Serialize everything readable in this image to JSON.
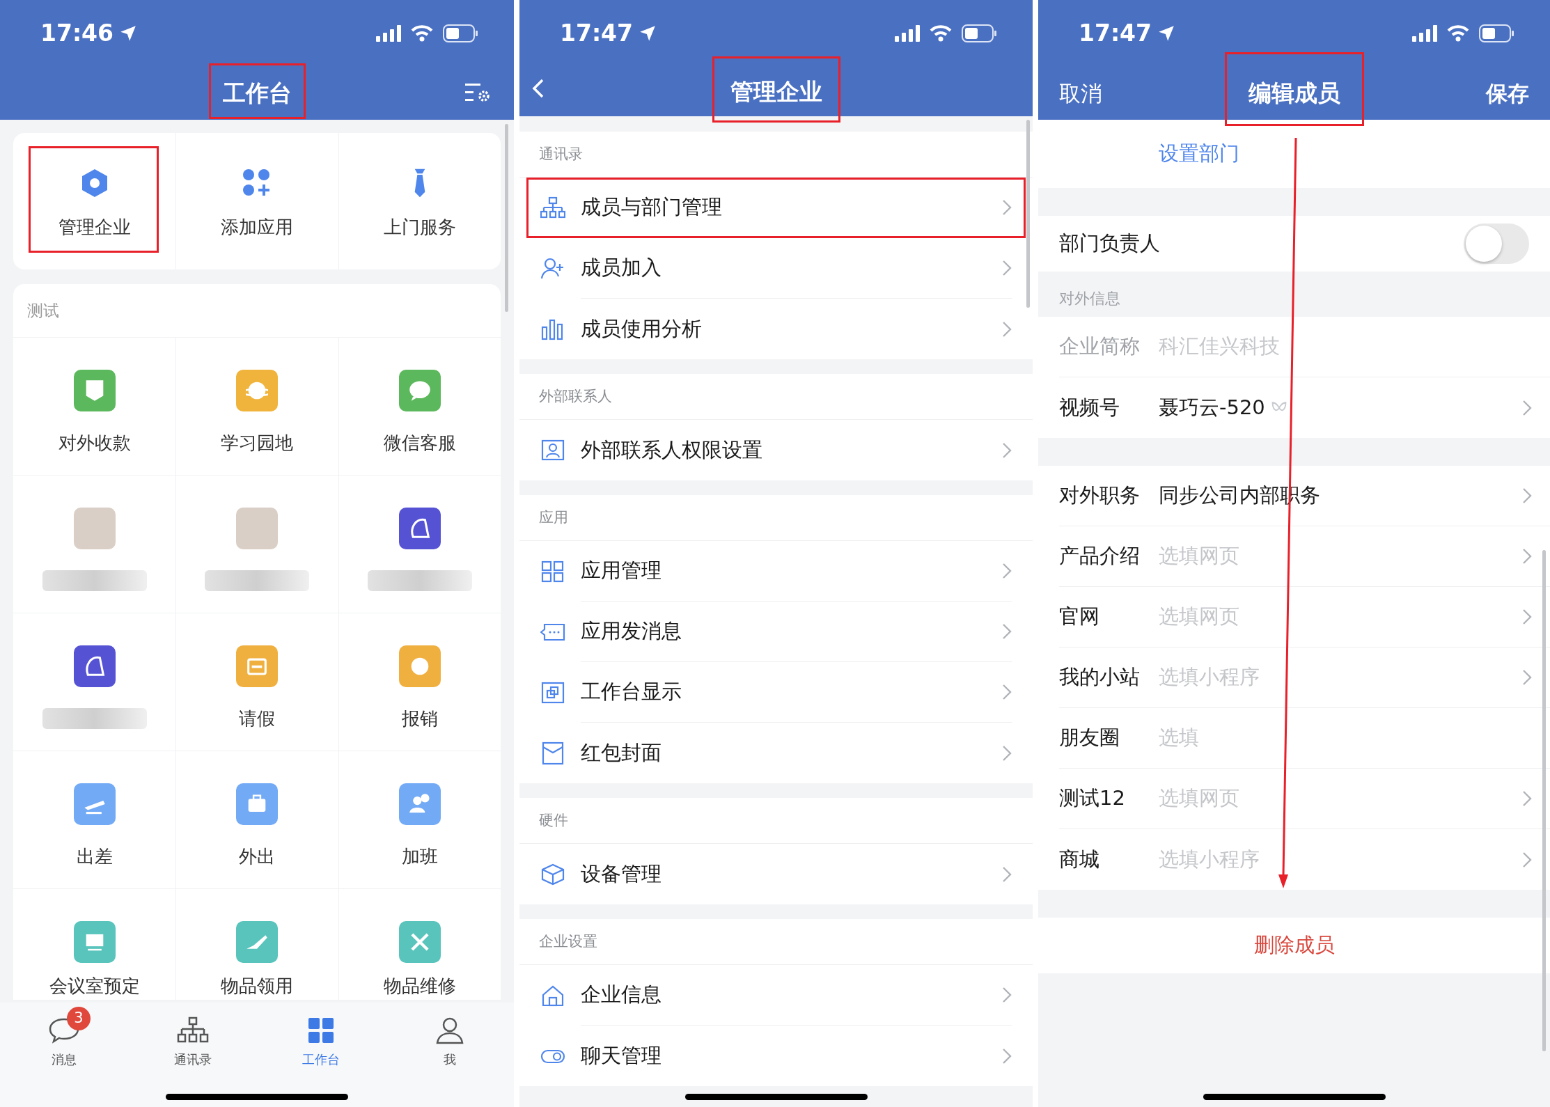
{
  "workbench": {
    "status_bar": {
      "time": "17:46"
    },
    "title": "工作台",
    "title_highlighted": true,
    "quick_actions": [
      {
        "label": "管理企业",
        "highlighted": true
      },
      {
        "label": "添加应用",
        "highlighted": false
      },
      {
        "label": "上门服务",
        "highlighted": false
      }
    ],
    "group_title": "测试",
    "apps": [
      {
        "kind": "app",
        "label": "对外收款",
        "color": "#5cb85c",
        "blurred": false
      },
      {
        "kind": "app",
        "label": "学习园地",
        "color": "#f0b43c",
        "blurred": false
      },
      {
        "kind": "app",
        "label": "微信客服",
        "color": "#5cb85c",
        "blurred": false
      },
      {
        "kind": "photo",
        "blurred": true
      },
      {
        "kind": "photo",
        "blurred": true
      },
      {
        "kind": "app",
        "color": "#5552d4",
        "blurred": true
      },
      {
        "kind": "app",
        "color": "#5552d4",
        "blurred": true
      },
      {
        "kind": "app",
        "label": "请假",
        "color": "#f0b040",
        "blurred": false
      },
      {
        "kind": "app",
        "label": "报销",
        "color": "#f0b040",
        "blurred": false
      },
      {
        "kind": "app",
        "label": "出差",
        "color": "#72aaf5",
        "blurred": false
      },
      {
        "kind": "app",
        "label": "外出",
        "color": "#72aaf5",
        "blurred": false
      },
      {
        "kind": "app",
        "label": "加班",
        "color": "#72aaf5",
        "blurred": false
      },
      {
        "kind": "app",
        "label": "会议室预定",
        "color": "#58c4bc",
        "blurred": false
      },
      {
        "kind": "app",
        "label": "物品领用",
        "color": "#58c4bc",
        "blurred": false
      },
      {
        "kind": "app",
        "label": "物品维修",
        "color": "#58c4bc",
        "blurred": false
      }
    ],
    "tab_bar": [
      {
        "label": "消息",
        "badge": "3",
        "selected": false
      },
      {
        "label": "通讯录",
        "selected": false
      },
      {
        "label": "工作台",
        "selected": true
      },
      {
        "label": "我",
        "selected": false
      }
    ]
  },
  "manage_enterprise": {
    "status_bar": {
      "time": "17:47"
    },
    "title": "管理企业",
    "title_highlighted": true,
    "sections": [
      {
        "title": "通讯录",
        "items": [
          {
            "label": "成员与部门管理",
            "highlighted": true
          },
          {
            "label": "成员加入",
            "highlighted": false
          },
          {
            "label": "成员使用分析",
            "highlighted": false
          }
        ]
      },
      {
        "title": "外部联系人",
        "items": [
          {
            "label": "外部联系人权限设置",
            "highlighted": false
          }
        ]
      },
      {
        "title": "应用",
        "items": [
          {
            "label": "应用管理",
            "highlighted": false
          },
          {
            "label": "应用发消息",
            "highlighted": false
          },
          {
            "label": "工作台显示",
            "highlighted": false
          },
          {
            "label": "红包封面",
            "highlighted": false
          }
        ]
      },
      {
        "title": "硬件",
        "items": [
          {
            "label": "设备管理",
            "highlighted": false
          }
        ]
      },
      {
        "title": "企业设置",
        "items": [
          {
            "label": "企业信息",
            "highlighted": false
          },
          {
            "label": "聊天管理",
            "highlighted": false
          }
        ]
      }
    ]
  },
  "edit_member": {
    "status_bar": {
      "time": "17:47"
    },
    "cancel": "取消",
    "title": "编辑成员",
    "title_highlighted": true,
    "save": "保存",
    "annotation_arrow": true,
    "rows": [
      {
        "kind": "link",
        "label": "设置部门"
      },
      {
        "kind": "gap"
      },
      {
        "kind": "toggle",
        "label": "部门负责人",
        "on": false
      },
      {
        "kind": "header",
        "label": "对外信息"
      },
      {
        "kind": "field",
        "label": "企业简称",
        "value": "科汇佳兴科技",
        "disabled": true,
        "chevron": false
      },
      {
        "kind": "field",
        "label": "视频号",
        "value": "聂巧云-520",
        "channel_icon": true,
        "disabled": false,
        "chevron": true
      },
      {
        "kind": "gap"
      },
      {
        "kind": "field",
        "label": "对外职务",
        "value": "同步公司内部职务",
        "disabled": false,
        "chevron": true
      },
      {
        "kind": "field",
        "label": "产品介绍",
        "placeholder": "选填网页",
        "disabled": false,
        "chevron": true
      },
      {
        "kind": "field",
        "label": "官网",
        "placeholder": "选填网页",
        "disabled": false,
        "chevron": true
      },
      {
        "kind": "field",
        "label": "我的小站",
        "placeholder": "选填小程序",
        "disabled": false,
        "chevron": true
      },
      {
        "kind": "field",
        "label": "朋友圈",
        "placeholder": "选填",
        "disabled": false,
        "chevron": false
      },
      {
        "kind": "field",
        "label": "测试12",
        "placeholder": "选填网页",
        "disabled": false,
        "chevron": true
      },
      {
        "kind": "field",
        "label": "商城",
        "placeholder": "选填小程序",
        "disabled": false,
        "chevron": true
      },
      {
        "kind": "gap"
      },
      {
        "kind": "danger",
        "label": "删除成员"
      }
    ]
  }
}
